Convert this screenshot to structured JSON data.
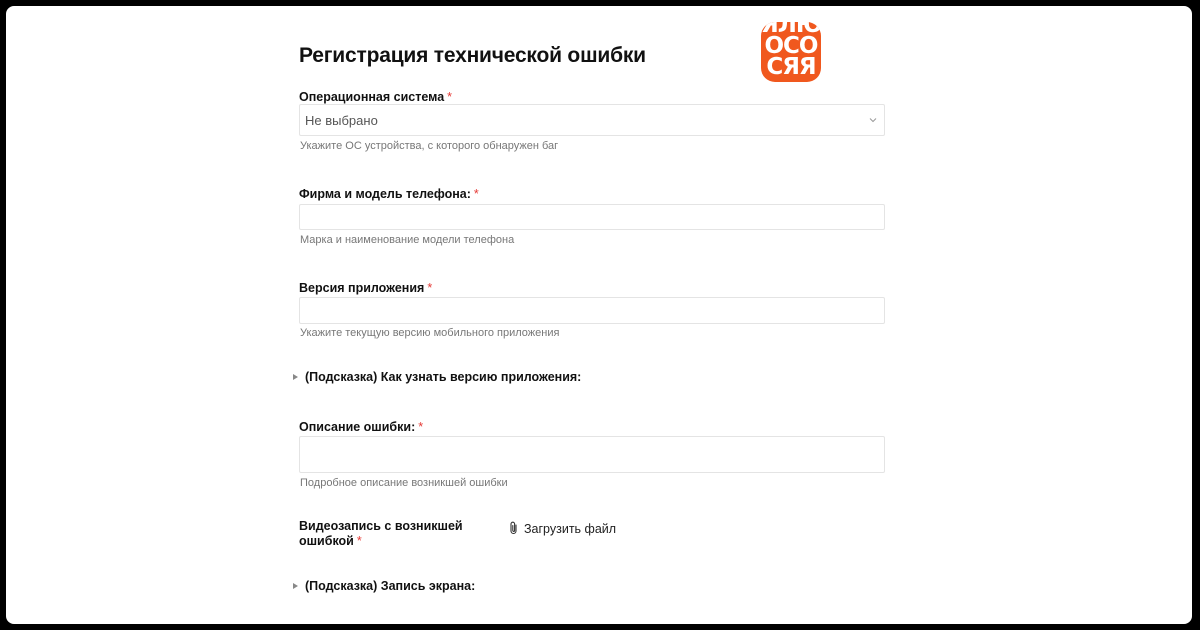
{
  "form": {
    "title": "Регистрация технической ошибки",
    "logo_lines": [
      "ЯЛЮ",
      "ОСО",
      "СЯЯ"
    ],
    "required_mark": "*",
    "os": {
      "label": "Операционная система",
      "selected": "Не выбрано",
      "hint": "Укажите ОС устройства, с которого обнаружен баг"
    },
    "phone_model": {
      "label": "Фирма и модель телефона:",
      "value": "",
      "hint": "Марка и наименование модели телефона"
    },
    "app_version": {
      "label": "Версия приложения",
      "value": "",
      "hint": "Укажите текущую версию мобильного приложения"
    },
    "version_tip": "(Подсказка) Как узнать версию приложения:",
    "description": {
      "label": "Описание ошибки:",
      "value": "",
      "hint": "Подробное описание возникшей ошибки"
    },
    "video": {
      "label_line1": "Видеозапись с возникшей",
      "label_line2": "ошибкой",
      "upload_label": "Загрузить файл"
    },
    "screen_tip": "(Подсказка) Запись экрана:"
  },
  "colors": {
    "brand": "#f0581e",
    "required": "#e53935"
  }
}
